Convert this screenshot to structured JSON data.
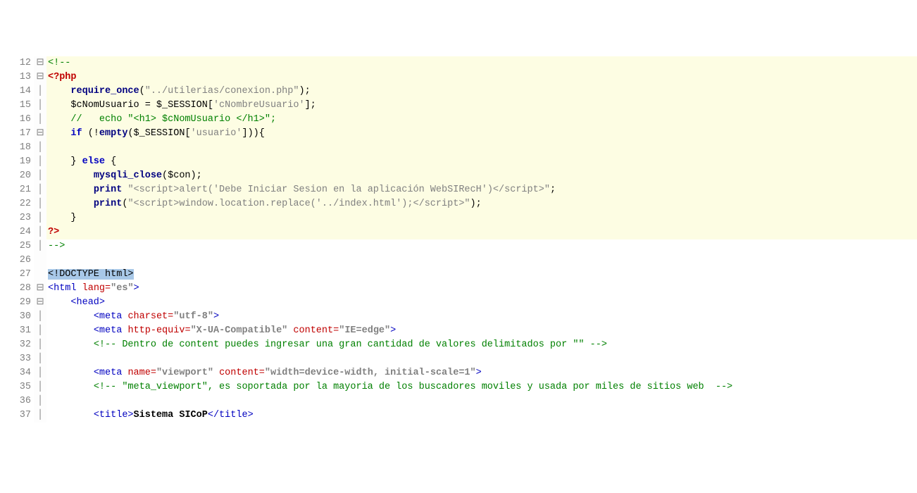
{
  "lines": {
    "start": 12,
    "end": 37
  },
  "fold": {
    "12": "⊟",
    "13": "⊟",
    "17": "⊟",
    "24": "└",
    "25": "└",
    "28": "⊟",
    "29": "⊟"
  },
  "code": {
    "12": [
      [
        "com",
        "<!--"
      ]
    ],
    "13": [
      [
        "php",
        "<?php"
      ]
    ],
    "14": [
      [
        "black",
        "    "
      ],
      [
        "fn",
        "require_once"
      ],
      [
        "black",
        "("
      ],
      [
        "strp",
        "\"../utilerias/conexion.php\""
      ],
      [
        "black",
        ");"
      ]
    ],
    "15": [
      [
        "black",
        "    $cNomUsuario = $_SESSION["
      ],
      [
        "strp",
        "'cNombreUsuario'"
      ],
      [
        "black",
        "];"
      ]
    ],
    "16": [
      [
        "black",
        "    "
      ],
      [
        "com",
        "//   echo \"<h1> $cNomUsuario </h1>\";"
      ]
    ],
    "17": [
      [
        "black",
        "    "
      ],
      [
        "kw",
        "if"
      ],
      [
        "black",
        " (!"
      ],
      [
        "fn",
        "empty"
      ],
      [
        "black",
        "($_SESSION["
      ],
      [
        "strp",
        "'usuario'"
      ],
      [
        "black",
        "])){"
      ]
    ],
    "18": [
      [
        "black",
        ""
      ]
    ],
    "19": [
      [
        "black",
        "    } "
      ],
      [
        "kw",
        "else"
      ],
      [
        "black",
        " {"
      ]
    ],
    "20": [
      [
        "black",
        "        "
      ],
      [
        "fn",
        "mysqli_close"
      ],
      [
        "black",
        "($con);"
      ]
    ],
    "21": [
      [
        "black",
        "        "
      ],
      [
        "fn",
        "print"
      ],
      [
        "black",
        " "
      ],
      [
        "strp",
        "\"<script>alert('Debe Iniciar Sesion en la aplicación WebSIRecH')</script>\""
      ],
      [
        "black",
        ";"
      ]
    ],
    "22": [
      [
        "black",
        "        "
      ],
      [
        "fn",
        "print"
      ],
      [
        "black",
        "("
      ],
      [
        "strp",
        "\"<script>window.location.replace('../index.html');</script>\""
      ],
      [
        "black",
        ");"
      ]
    ],
    "23": [
      [
        "black",
        "    }"
      ]
    ],
    "24": [
      [
        "php",
        "?>"
      ]
    ],
    "25": [
      [
        "com",
        "-->"
      ]
    ],
    "26": [
      [
        "black",
        ""
      ]
    ],
    "27": [
      [
        "doctype-sel",
        "<!"
      ],
      [
        "doctype-sel",
        "DOCTYPE html"
      ],
      [
        "doctype-sel",
        ">"
      ]
    ],
    "28": [
      [
        "tag",
        "<html"
      ],
      [
        "black",
        " "
      ],
      [
        "attr",
        "lang="
      ],
      [
        "strp",
        "\"es\""
      ],
      [
        "tag",
        ">"
      ]
    ],
    "29": [
      [
        "black",
        "    "
      ],
      [
        "tag",
        "<head>"
      ]
    ],
    "30": [
      [
        "black",
        "        "
      ],
      [
        "tag",
        "<meta"
      ],
      [
        "black",
        " "
      ],
      [
        "attr",
        "charset="
      ],
      [
        "strp",
        "\"utf-8\""
      ],
      [
        "tag",
        ">"
      ]
    ],
    "31": [
      [
        "black",
        "        "
      ],
      [
        "tag",
        "<meta"
      ],
      [
        "black",
        " "
      ],
      [
        "attr",
        "http-equiv="
      ],
      [
        "strp",
        "\"X-UA-Compatible\""
      ],
      [
        "black",
        " "
      ],
      [
        "attr",
        "content="
      ],
      [
        "strp",
        "\"IE=edge\""
      ],
      [
        "tag",
        ">"
      ]
    ],
    "32": [
      [
        "black",
        "        "
      ],
      [
        "com",
        "<!-- Dentro de content puedes ingresar una gran cantidad de valores delimitados por \"\" -->"
      ]
    ],
    "33": [
      [
        "black",
        ""
      ]
    ],
    "34": [
      [
        "black",
        "        "
      ],
      [
        "tag",
        "<meta"
      ],
      [
        "black",
        " "
      ],
      [
        "attr",
        "name="
      ],
      [
        "strp",
        "\"viewport\""
      ],
      [
        "black",
        " "
      ],
      [
        "attr",
        "content="
      ],
      [
        "strp",
        "\"width=device-width, initial-scale=1\""
      ],
      [
        "tag",
        ">"
      ]
    ],
    "35": [
      [
        "black",
        "        "
      ],
      [
        "com",
        "<!-- \"meta_viewport\", es soportada por la mayoria de los buscadores moviles y usada por miles de sitios web  -->"
      ]
    ],
    "36": [
      [
        "black",
        ""
      ]
    ],
    "37": [
      [
        "black",
        "        "
      ],
      [
        "tag",
        "<title>"
      ],
      [
        "boldblack",
        "Sistema SICoP"
      ],
      [
        "tag",
        "</title>"
      ]
    ]
  },
  "highlight": {
    "from": 12,
    "to": 24
  },
  "bold_strings": [
    "X-UA-Compatible",
    "IE=edge",
    "viewport",
    "width=device-width, initial-scale=1",
    "utf-8",
    "es"
  ]
}
